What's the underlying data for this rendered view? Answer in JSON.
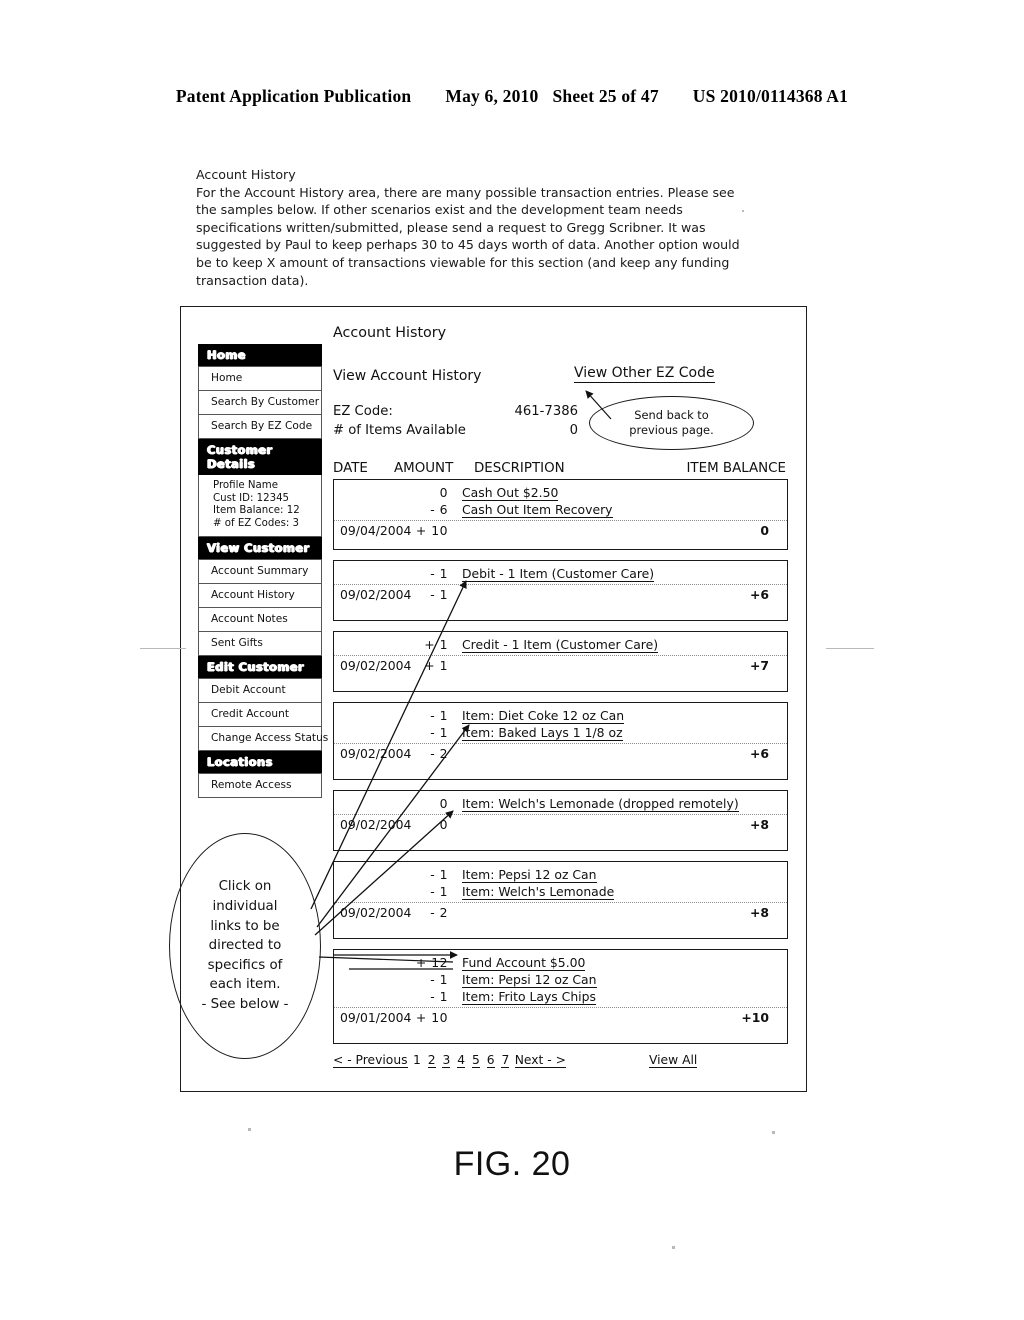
{
  "patent_header": {
    "publication": "Patent Application Publication",
    "date": "May 6, 2010",
    "sheet": "Sheet 25 of 47",
    "number": "US 2010/0114368 A1"
  },
  "intro": {
    "title": "Account History",
    "lines": [
      "For the Account History area, there are many possible transaction entries.  Please see",
      "the samples below.  If other scenarios exist and the development team needs",
      "specifications written/submitted, please send a request to Gregg Scribner.   It was",
      "suggested by Paul to keep perhaps 30 to 45 days worth of data.  Another option would",
      "be to keep X amount of transactions viewable for this section (and keep any funding",
      "transaction data)."
    ]
  },
  "sidebar": {
    "groups": [
      {
        "header": "Home",
        "items": [
          "Home",
          "Search By Customer",
          "Search By EZ Code"
        ]
      },
      {
        "header": "Customer Details",
        "info": [
          "Profile Name",
          "Cust ID: 12345",
          "Item Balance: 12",
          "# of EZ Codes: 3"
        ]
      },
      {
        "header": "View Customer",
        "items": [
          "Account Summary",
          "Account History",
          "Account Notes",
          "Sent Gifts"
        ]
      },
      {
        "header": "Edit Customer",
        "items": [
          "Debit Account",
          "Credit Account",
          "Change Access Status"
        ]
      },
      {
        "header": "Locations",
        "items": [
          "Remote Access"
        ]
      }
    ]
  },
  "main": {
    "title": "Account History",
    "subtitle": "View Account History",
    "view_other_link": "View Other EZ Code",
    "fields": [
      {
        "label": "EZ Code:",
        "value": "461-7386"
      },
      {
        "label": "# of Items Available",
        "value": "0"
      }
    ],
    "columns": {
      "date": "DATE",
      "amount": "AMOUNT",
      "description": "DESCRIPTION",
      "balance": "ITEM BALANCE"
    },
    "transactions": [
      {
        "lines": [
          {
            "amount": "0",
            "description": "Cash Out $2.50"
          },
          {
            "amount": "- 6",
            "description": "Cash Out Item Recovery"
          }
        ],
        "date": "09/04/2004",
        "total": "+ 10",
        "balance": "0"
      },
      {
        "lines": [
          {
            "amount": "- 1",
            "description": "Debit - 1 Item (Customer Care)"
          }
        ],
        "date": "09/02/2004",
        "total": "- 1",
        "balance": "+6"
      },
      {
        "lines": [
          {
            "amount": "+ 1",
            "description": "Credit - 1 Item (Customer Care)"
          }
        ],
        "date": "09/02/2004",
        "total": "+ 1",
        "balance": "+7"
      },
      {
        "lines": [
          {
            "amount": "- 1",
            "description": "Item: Diet Coke 12 oz Can"
          },
          {
            "amount": "- 1",
            "description": "Item: Baked Lays 1 1/8 oz"
          }
        ],
        "date": "09/02/2004",
        "total": "- 2",
        "balance": "+6"
      },
      {
        "lines": [
          {
            "amount": "0",
            "description": "Item: Welch's Lemonade (dropped remotely)"
          }
        ],
        "date": "09/02/2004",
        "total": "0",
        "balance": "+8"
      },
      {
        "lines": [
          {
            "amount": "- 1",
            "description": "Item: Pepsi 12 oz Can"
          },
          {
            "amount": "- 1",
            "description": "Item: Welch's Lemonade"
          }
        ],
        "date": "09/02/2004",
        "total": "- 2",
        "balance": "+8"
      },
      {
        "lines": [
          {
            "amount": "+ 12",
            "description": "Fund Account $5.00"
          },
          {
            "amount": "- 1",
            "description": "Item: Pepsi 12 oz Can"
          },
          {
            "amount": "- 1",
            "description": "Item: Frito Lays Chips"
          }
        ],
        "date": "09/01/2004",
        "total": "+ 10",
        "balance": "+10"
      }
    ],
    "pager": {
      "previous": "< - Previous",
      "pages": [
        "1",
        "2",
        "3",
        "4",
        "5",
        "6",
        "7"
      ],
      "next": "Next - >",
      "view_all": "View All"
    }
  },
  "callouts": {
    "send_back": [
      "Send back to",
      "previous page."
    ],
    "click_links": [
      "Click on",
      "individual",
      "links to be",
      "directed to",
      "specifics of",
      "each item.",
      "- See below -"
    ]
  },
  "figure_caption": "FIG. 20"
}
